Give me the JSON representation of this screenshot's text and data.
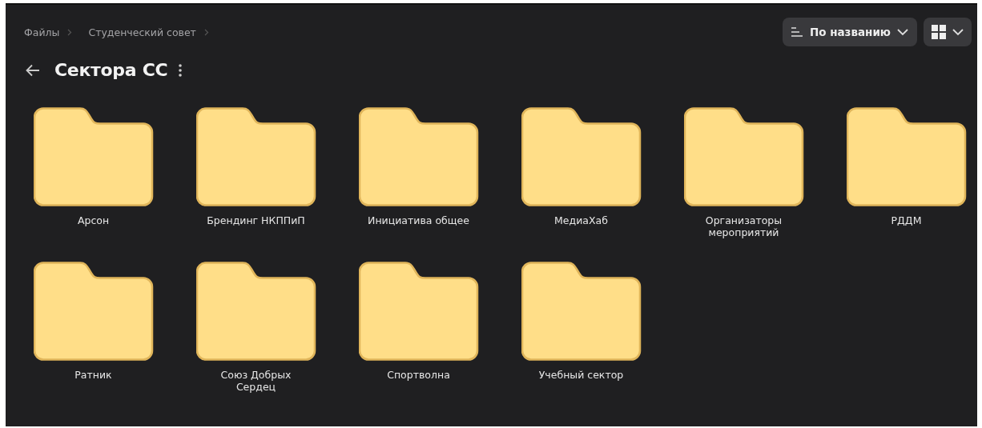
{
  "breadcrumbs": [
    "Файлы",
    "Студенческий совет"
  ],
  "title": "Сектора СС",
  "sort_button": {
    "label": "По названию"
  },
  "folders": [
    {
      "name": "Арсон"
    },
    {
      "name": "Брендинг НКППиП"
    },
    {
      "name": "Инициатива общее"
    },
    {
      "name": "МедиаХаб"
    },
    {
      "name": "Организаторы мероприятий"
    },
    {
      "name": "РДДМ"
    },
    {
      "name": "Ратник"
    },
    {
      "name": "Союз Добрых Сердец"
    },
    {
      "name": "Спортволна"
    },
    {
      "name": "Учебный сектор"
    }
  ]
}
